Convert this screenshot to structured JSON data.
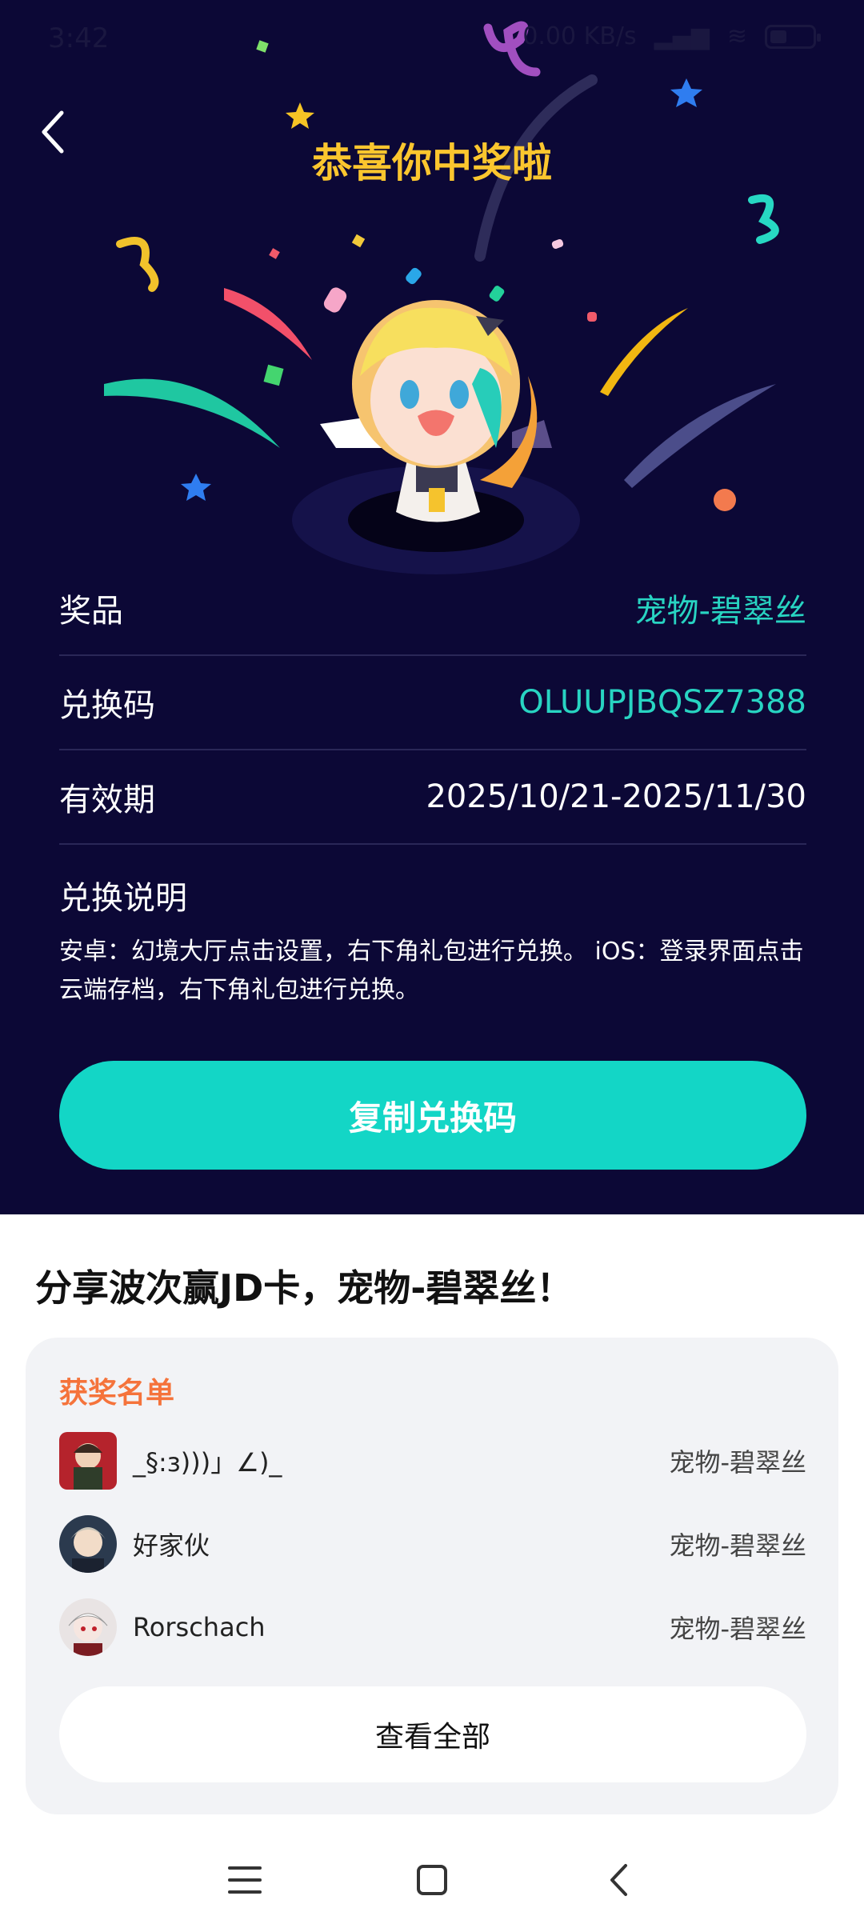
{
  "status": {
    "time": "3:42",
    "network": "0.00 KB/s",
    "battery_level": 0.35
  },
  "header": {
    "title": "恭喜你中奖啦"
  },
  "prize_info": {
    "prize_label": "奖品",
    "prize_value": "宠物-碧翠丝",
    "code_label": "兑换码",
    "code_value": "OLUUPJBQSZ7388",
    "validity_label": "有效期",
    "validity_value": "2025/10/21-2025/11/30"
  },
  "instructions": {
    "title": "兑换说明",
    "text": "安卓：幻境大厅点击设置，右下角礼包进行兑换。 iOS：登录界面点击云端存档，右下角礼包进行兑换。"
  },
  "copy_button": "复制兑换码",
  "share": {
    "title": "分享波次赢JD卡，宠物-碧翠丝！"
  },
  "winners": {
    "heading": "获奖名单",
    "items": [
      {
        "name": "_§:з)))」∠)_",
        "prize": "宠物-碧翠丝"
      },
      {
        "name": "好家伙",
        "prize": "宠物-碧翠丝"
      },
      {
        "name": "Rorschach",
        "prize": "宠物-碧翠丝"
      }
    ],
    "view_all": "查看全部"
  },
  "colors": {
    "background": "#0c0836",
    "accent_teal": "#13d6c6",
    "title_yellow": "#fbc62e",
    "winners_orange": "#f5733b"
  },
  "icons": [
    "back-chevron-icon",
    "menu-icon",
    "home-square-icon",
    "back-arrow-icon"
  ]
}
